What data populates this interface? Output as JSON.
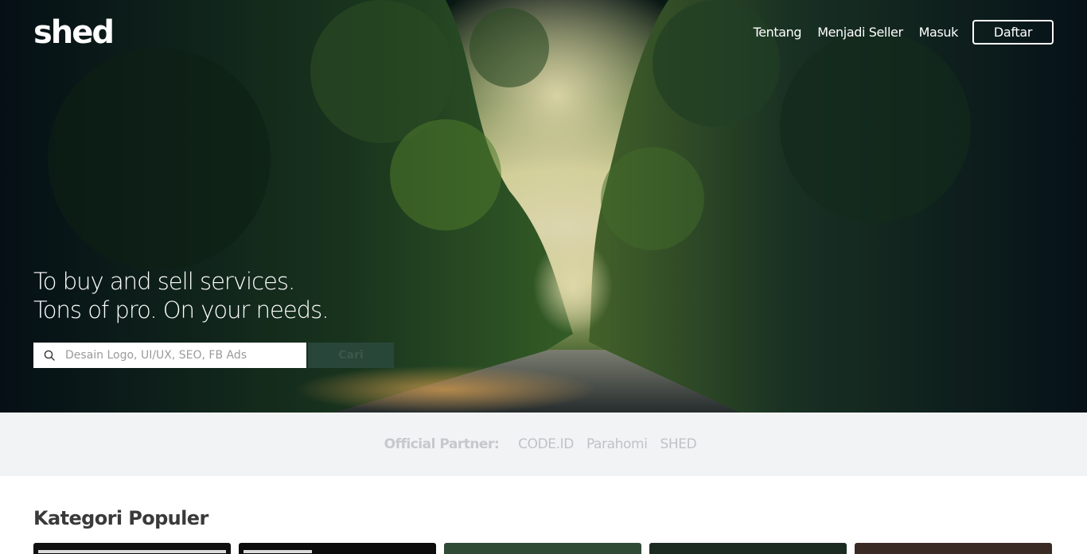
{
  "brand": {
    "logo_text": "shed"
  },
  "nav": {
    "links": [
      "Tentang",
      "Menjadi Seller",
      "Masuk"
    ],
    "register_label": "Daftar"
  },
  "hero": {
    "headline_line1": "To buy and sell services.",
    "headline_line2": "Tons of pro. On your needs.",
    "search": {
      "placeholder": "Desain Logo, UI/UX, SEO, FB Ads",
      "value": "",
      "button_label": "Cari"
    }
  },
  "partners": {
    "title": "Official Partner:",
    "items": [
      "CODE.ID",
      "Parahomi",
      "SHED"
    ]
  },
  "categories": {
    "title": "Kategori Populer",
    "cards": [
      {
        "color": "#111111"
      },
      {
        "color": "#0c0c0c"
      },
      {
        "color": "#2f4a35"
      },
      {
        "color": "#1c2b22"
      },
      {
        "color": "#3a2a24"
      }
    ]
  },
  "icons": {
    "search": "search-icon"
  }
}
